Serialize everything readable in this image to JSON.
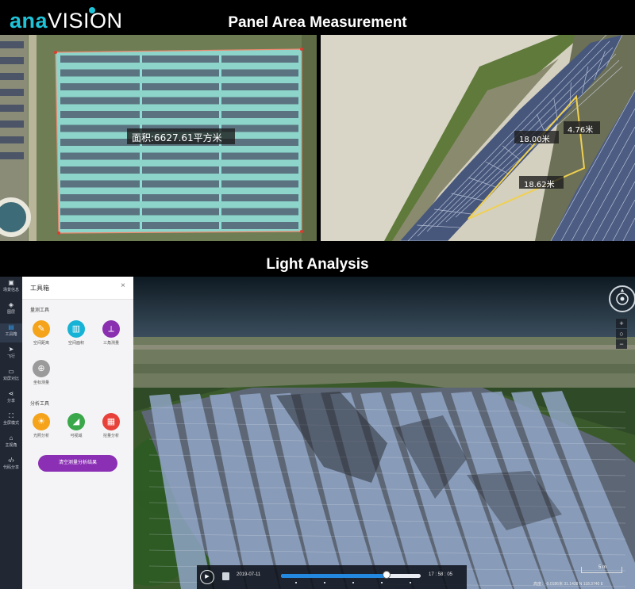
{
  "header": {
    "logo_ana": "ana",
    "logo_vision": "VISION",
    "title_top": "Panel Area Measurement",
    "title_bottom": "Light Analysis"
  },
  "measurements": {
    "area_label": "面积:6627.61平方米",
    "side_a": "4.76米",
    "side_b": "18.00米",
    "side_c": "18.62米"
  },
  "sidebar": {
    "items": [
      {
        "label": "场景信息",
        "icon": "info-icon"
      },
      {
        "label": "图层",
        "icon": "layers-icon"
      },
      {
        "label": "工具箱",
        "icon": "toolbox-icon",
        "active": true
      },
      {
        "label": "飞行",
        "icon": "flight-icon"
      },
      {
        "label": "双屏对比",
        "icon": "dual-screen-icon"
      },
      {
        "label": "分享",
        "icon": "share-icon"
      },
      {
        "label": "全屏模式",
        "icon": "fullscreen-icon"
      },
      {
        "label": "主视角",
        "icon": "home-icon"
      },
      {
        "label": "代码分享",
        "icon": "code-icon"
      }
    ]
  },
  "toolbox": {
    "title": "工具箱",
    "close": "×",
    "measure_section": "量测工具",
    "measure_tools": [
      {
        "label": "空间距离",
        "icon": "ruler-icon",
        "color": "#f5a31a"
      },
      {
        "label": "空间面积",
        "icon": "area-icon",
        "color": "#16b3d6"
      },
      {
        "label": "三角测量",
        "icon": "triangle-measure-icon",
        "color": "#8a2fb0"
      },
      {
        "label": "坐标测量",
        "icon": "coordinate-icon",
        "color": "#9a9a9a"
      }
    ],
    "analysis_section": "分析工具",
    "analysis_tools": [
      {
        "label": "光照分析",
        "icon": "sun-icon",
        "color": "#f5a31a"
      },
      {
        "label": "可视域",
        "icon": "viewshed-icon",
        "color": "#3aa84a"
      },
      {
        "label": "挖量分析",
        "icon": "volume-icon",
        "color": "#e8413a"
      }
    ],
    "clear_button": "清空测量分析结果"
  },
  "timeline": {
    "date": "2019-07-11",
    "time": "17 : 58 : 05",
    "progress": 0.75
  },
  "scale": "5 m",
  "status_coords": "高度：-0.0186米 31.1438 N 118.3740 E"
}
